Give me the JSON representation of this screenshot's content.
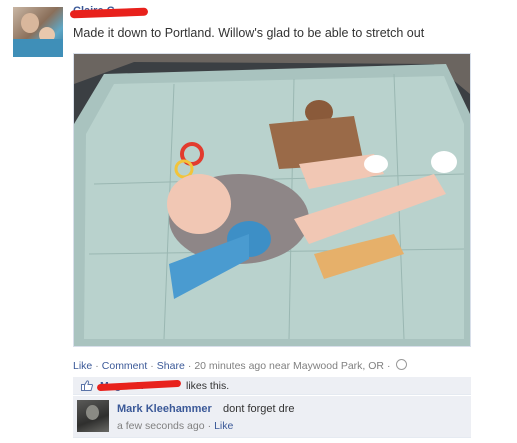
{
  "post": {
    "author": "Claire C",
    "message": "Made it down to Portland. Willow's glad to be able to stretch out",
    "photo_icon": "baby-on-play-mat-photo"
  },
  "actions": {
    "like": "Like",
    "comment": "Comment",
    "share": "Share",
    "timestamp": "20 minutes ago",
    "location": "near Maywood Park, OR",
    "privacy_icon": "globe-icon"
  },
  "likes": {
    "names": "Megan H",
    "text": "likes this.",
    "icon": "thumbs-up-icon"
  },
  "comment": {
    "author": "Mark Kleehammer",
    "text": "dont forget dre",
    "time": "a few seconds ago",
    "like": "Like"
  },
  "colors": {
    "link": "#3b5998",
    "comment_bg": "#edeff4",
    "redaction": "#e8211c"
  }
}
